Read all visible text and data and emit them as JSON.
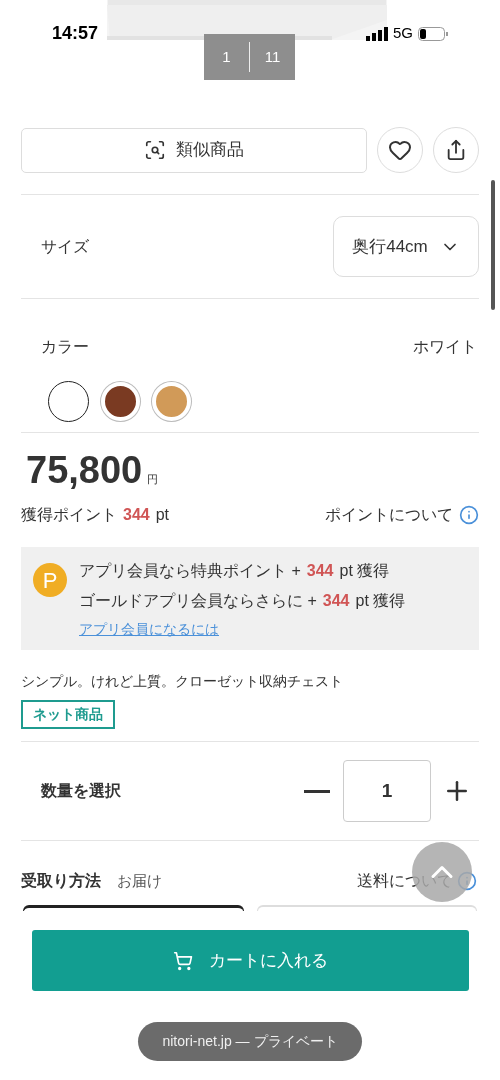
{
  "status_bar": {
    "time": "14:57",
    "network": "5G"
  },
  "gallery": {
    "counter": {
      "current": "1",
      "total": "11"
    }
  },
  "similar_button": {
    "label": "類似商品"
  },
  "size": {
    "label": "サイズ",
    "value": "奥行44cm"
  },
  "color": {
    "label": "カラー",
    "value": "ホワイト",
    "swatches": [
      {
        "color": "#ffffff",
        "selected": true
      },
      {
        "color": "#7a3a22",
        "selected": false
      },
      {
        "color": "#d19a58",
        "selected": false
      }
    ]
  },
  "price": {
    "amount": "75,800",
    "unit": "円"
  },
  "points": {
    "label": "獲得ポイント",
    "value": "344",
    "unit": "pt",
    "link": "ポイントについて"
  },
  "promo": {
    "badge": "P",
    "lines": [
      {
        "text": "アプリ会員なら特典ポイント +",
        "value": "344",
        "suffix": "pt 獲得"
      },
      {
        "text": "ゴールドアプリ会員ならさらに +",
        "value": "344",
        "suffix": "pt 獲得"
      }
    ],
    "link": "アプリ会員になるには"
  },
  "description": "シンプル。けれど上質。クローゼット収納チェスト",
  "tag": "ネット商品",
  "quantity": {
    "label": "数量を選択",
    "value": "1"
  },
  "delivery": {
    "label": "受取り方法",
    "value": "お届け",
    "link": "送料について",
    "options": [
      {
        "selected": true
      },
      {
        "selected": false
      }
    ]
  },
  "cart_button": {
    "label": "カートに入れる"
  },
  "url_bar": {
    "text": "nitori-net.jp — プライベート"
  }
}
